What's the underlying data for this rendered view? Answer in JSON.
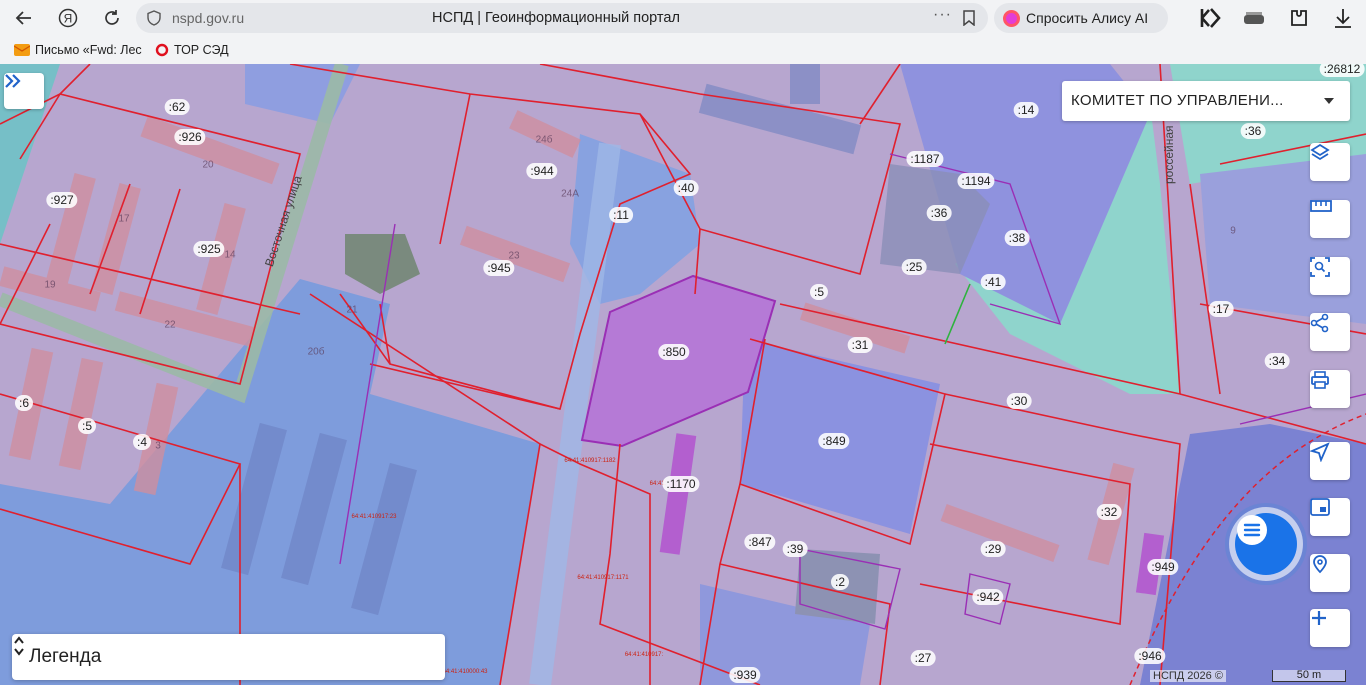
{
  "browser": {
    "url": "nspd.gov.ru",
    "page_title": "НСПД | Геоинформационный портал",
    "more_label": "···",
    "alice_label": "Спросить Алису AI",
    "bookmarks": [
      {
        "label": "Письмо «Fwd: Лес"
      },
      {
        "label": "ТОР СЭД"
      }
    ]
  },
  "map": {
    "owner_select": "КОМИТЕТ ПО УПРАВЛЕНИ...",
    "legend_title": "Легенда",
    "copyright": "НСПД 2026 ©",
    "scale_label": "50 m",
    "street_names": [
      "Восточная улица",
      "россейная"
    ],
    "parcel_labels": [
      ":62",
      ":926",
      ":927",
      ":925",
      ":944",
      ":945",
      ":11",
      ":40",
      ":850",
      ":5",
      ":31",
      ":849",
      ":1170",
      ":847",
      ":39",
      ":2",
      ":942",
      ":29",
      ":32",
      ":30",
      ":1187",
      ":1194",
      ":36",
      ":38",
      ":25",
      ":41",
      ":14",
      ":36",
      ":17",
      ":34",
      ":6",
      ":5",
      ":4",
      ":949",
      ":946",
      ":939",
      ":27",
      ":26812"
    ],
    "building_numbers": [
      "20",
      "17",
      "14",
      "19",
      "22",
      "24б",
      "24А",
      "23",
      "21",
      "20б",
      "3",
      "9"
    ],
    "cadastral_numbers": [
      "64:41:410917:1182",
      "64:41:410917:23",
      "64:41:410917:1171",
      "64:41:410917:",
      "64:41:410000:43",
      "64:41:"
    ]
  },
  "colors": {
    "parcel_fill": "#c499c8",
    "parcel_border": "#e0202e",
    "blue_zone": "#7e9cdc",
    "selected_parcel": "#b57ad6",
    "teal_zone": "#7ecfc8",
    "accent_blue": "#1a73e8"
  }
}
